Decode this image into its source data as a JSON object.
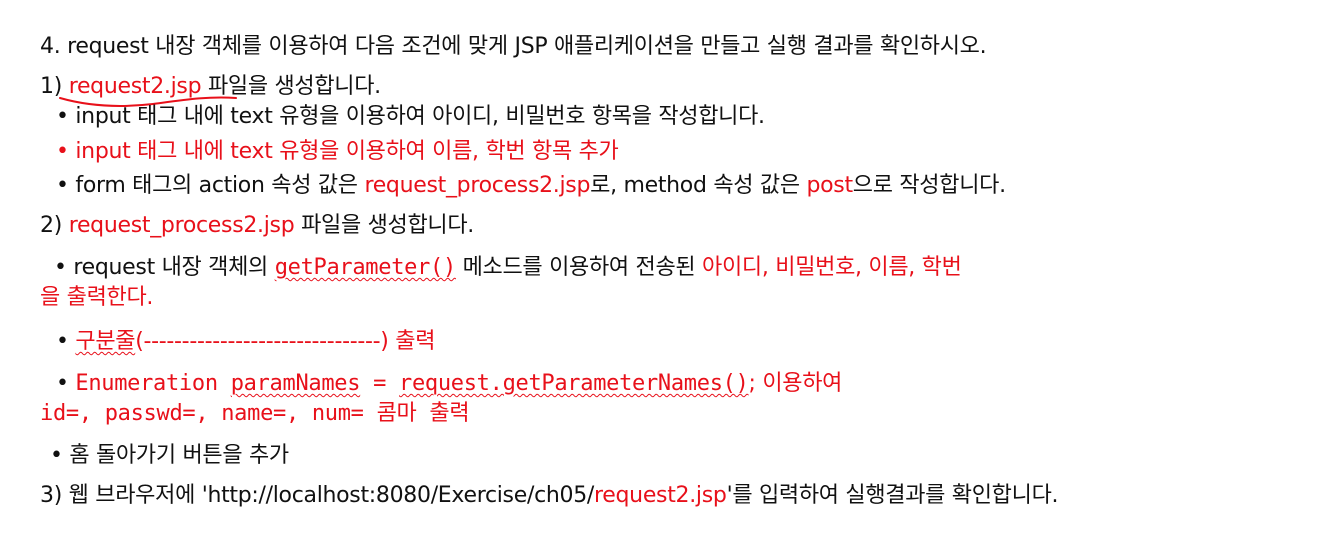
{
  "doc": {
    "heading": "4. request 내장 객체를 이용하여 다음 조건에 맞게 JSP 애플리케이션을 만들고 실행 결과를 확인하시오.",
    "s1": {
      "num": "1) ",
      "file": "request2.jsp",
      "rest": " 파일을 생성합니다.",
      "b1": "• input 태그 내에 text 유형을 이용하여 아이디, 비밀번호 항목을 작성합니다.",
      "b2": "• input 태그 내에 text 유형을 이용하여 이름, 학번 항목 추가",
      "b3": {
        "a": "• form 태그의 action 속성 값은 ",
        "b": "request_process2.jsp",
        "c": "로, method 속성 값은 ",
        "d": "post",
        "e": "으로 작성합니다."
      }
    },
    "s2": {
      "num": "2) ",
      "file": "request_process2.jsp",
      "rest": " 파일을 생성합니다.",
      "b1": {
        "a": " • request 내장 객체의 ",
        "b": "getParameter()",
        "c": "  메소드를 이용하여 전송된 ",
        "d": "아이디, 비밀번호, 이름, 학번",
        "e": "을 출력한다."
      },
      "b2": {
        "bullet": "• ",
        "a": "구분줄",
        "b": "(-------------------------------) 출력"
      },
      "b3": {
        "bullet": "• ",
        "a": "Enumeration ",
        "b": "paramNames",
        "c": " = ",
        "d": "request.getParameterNames()",
        "e": "; 이용하여",
        "f": "id=, passwd=, name=, num= 콤마 출력"
      },
      "b4": "• 홈 돌아가기 버튼을 추가"
    },
    "s3": {
      "a": "3) 웹 브라우저에 'http://localhost:8080/Exercise/ch05/",
      "b": "request2.jsp",
      "c": "'를 입력하여 실행결과를 확인합니다."
    }
  },
  "colors": {
    "text": "#111111",
    "accent_red": "#e8101a"
  }
}
